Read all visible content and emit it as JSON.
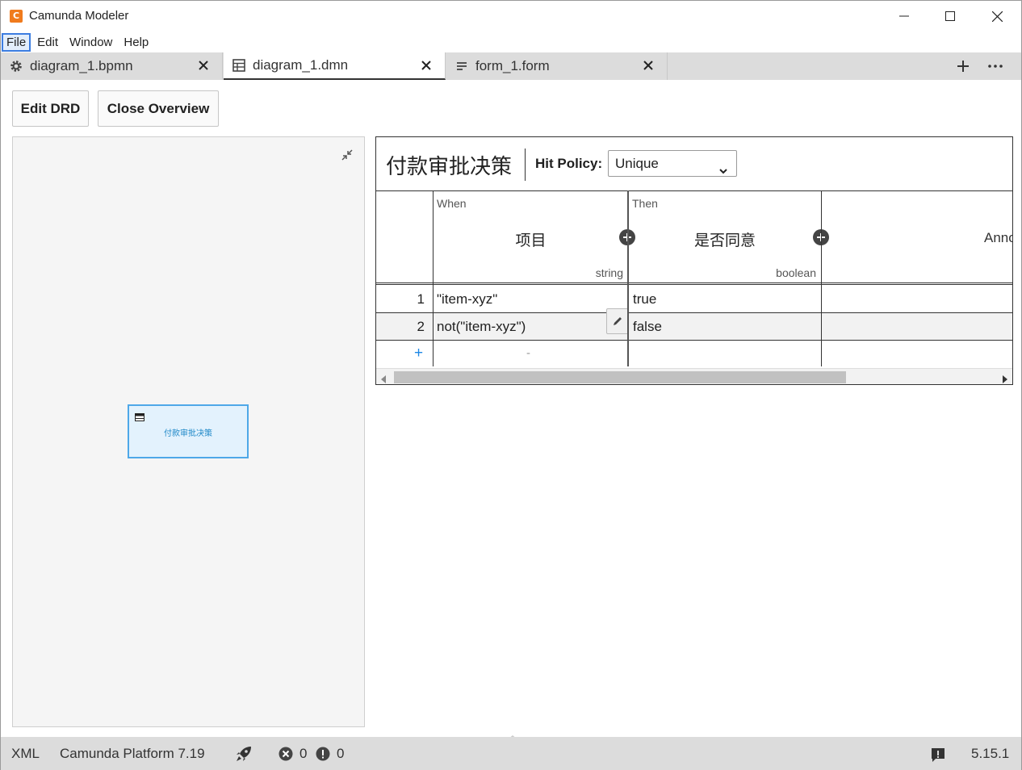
{
  "window": {
    "title": "Camunda Modeler",
    "logo_glyph": "C",
    "controls": [
      "minimize-icon",
      "maximize-icon",
      "close-icon"
    ]
  },
  "menu": {
    "items": [
      {
        "label": "File",
        "active": true
      },
      {
        "label": "Edit"
      },
      {
        "label": "Window"
      },
      {
        "label": "Help"
      }
    ]
  },
  "tabs": [
    {
      "label": "diagram_1.bpmn",
      "icon": "gear-icon",
      "active": false
    },
    {
      "label": "diagram_1.dmn",
      "icon": "table-icon",
      "active": true
    },
    {
      "label": "form_1.form",
      "icon": "form-icon",
      "active": false
    }
  ],
  "toolbar": {
    "edit_drd_label": "Edit DRD",
    "close_overview_label": "Close Overview"
  },
  "overview": {
    "node_label": "付款审批决策"
  },
  "decision_table": {
    "name": "付款审批决策",
    "hit_policy_label": "Hit Policy:",
    "hit_policy_value": "Unique",
    "input_clause": "When",
    "input_label": "项目",
    "input_type": "string",
    "output_clause": "Then",
    "output_label": "是否同意",
    "output_type": "boolean",
    "annotation_label": "Annotations",
    "rows": [
      {
        "index": "1",
        "input": "\"item-xyz\"",
        "output": "true"
      },
      {
        "index": "2",
        "input": "not(\"item-xyz\")",
        "output": "false"
      }
    ],
    "add_row_label": "+",
    "empty_cell": "-"
  },
  "statusbar": {
    "xml_label": "XML",
    "platform": "Camunda Platform 7.19",
    "errors": "0",
    "warnings": "0",
    "version": "5.15.1"
  },
  "colors": {
    "accent": "#3c7de0",
    "drd_node_border": "#4ea8e8",
    "drd_node_fill": "#e3f2fd",
    "brand_orange": "#f07b1d",
    "add_row_blue": "#1e88e5"
  }
}
